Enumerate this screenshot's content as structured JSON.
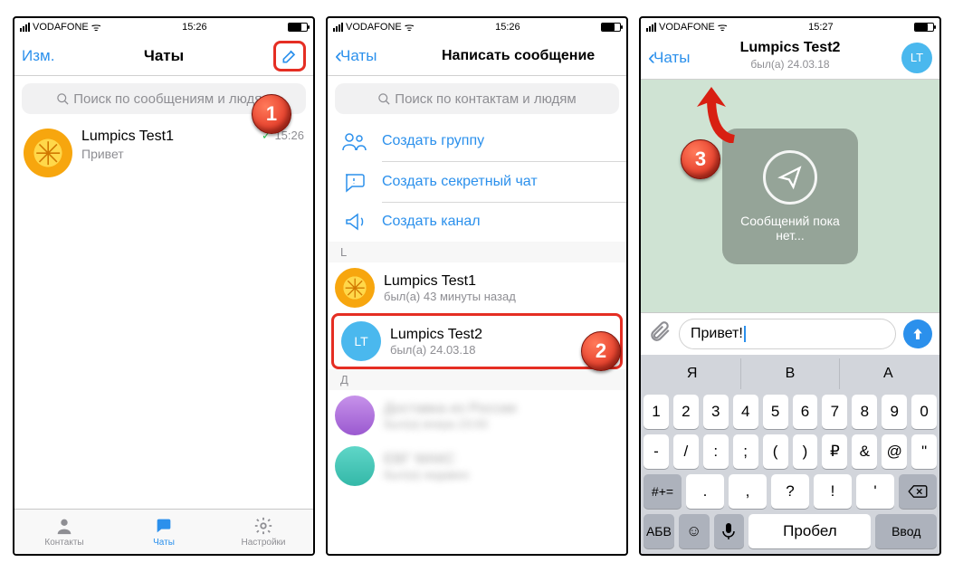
{
  "callouts": [
    "1",
    "2",
    "3"
  ],
  "screen1": {
    "status": {
      "carrier": "VODAFONE",
      "time": "15:26"
    },
    "nav": {
      "edit": "Изм.",
      "title": "Чаты"
    },
    "search_placeholder": "Поиск по сообщениям и людям",
    "chat": {
      "name": "Lumpics Test1",
      "preview": "Привет",
      "time": "15:26"
    },
    "tabs": {
      "contacts": "Контакты",
      "chats": "Чаты",
      "settings": "Настройки"
    }
  },
  "screen2": {
    "status": {
      "carrier": "VODAFONE",
      "time": "15:26"
    },
    "nav": {
      "back": "Чаты",
      "title": "Написать сообщение"
    },
    "search_placeholder": "Поиск по контактам и людям",
    "options": {
      "group": "Создать группу",
      "secret": "Создать секретный чат",
      "channel": "Создать канал"
    },
    "section_L": "L",
    "contact1": {
      "name": "Lumpics Test1",
      "sub": "был(а) 43 минуты назад"
    },
    "contact2": {
      "name": "Lumpics Test2",
      "sub": "был(а) 24.03.18",
      "initials": "LT"
    },
    "section_D": "Д",
    "blur1": {
      "name": "Доставка из России",
      "sub": "был(а) вчера 23:00"
    },
    "blur2": {
      "name": "ЕВГ МАКС",
      "sub": "был(а) недавно"
    }
  },
  "screen3": {
    "status": {
      "carrier": "VODAFONE",
      "time": "15:27"
    },
    "nav": {
      "back": "Чаты",
      "title": "Lumpics Test2",
      "subtitle": "был(а) 24.03.18",
      "initials": "LT"
    },
    "empty": "Сообщений пока нет...",
    "input_value": "Привет!",
    "suggest": [
      "Я",
      "В",
      "А"
    ],
    "row_num": [
      "1",
      "2",
      "3",
      "4",
      "5",
      "6",
      "7",
      "8",
      "9",
      "0"
    ],
    "row_sym": [
      "-",
      "/",
      ":",
      ";",
      "(",
      ")",
      "₽",
      "&",
      "@",
      "\""
    ],
    "row_punct_shift": "#+=",
    "row_punct": [
      ".",
      "",
      ",",
      "",
      "?",
      "",
      "!",
      "",
      "'"
    ],
    "abc": "АБВ",
    "space": "Пробел",
    "enter": "Ввод"
  }
}
